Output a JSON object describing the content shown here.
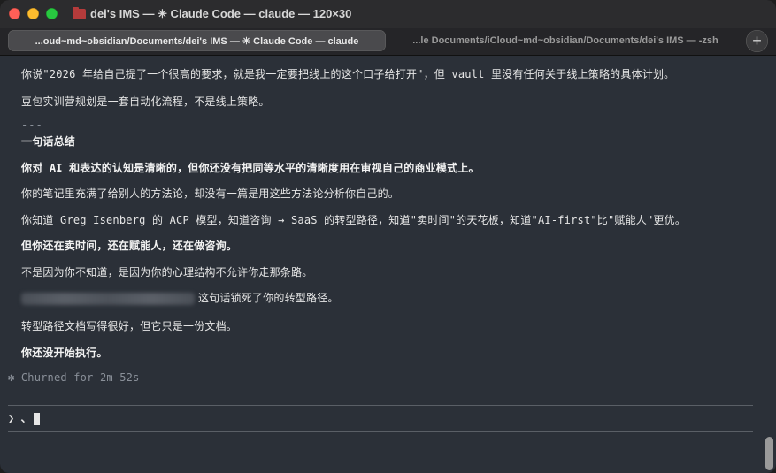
{
  "window": {
    "title": "dei's IMS — ✳ Claude Code — claude — 120×30",
    "folder_icon": "folder-icon"
  },
  "tabs": [
    {
      "label": "...oud~md~obsidian/Documents/dei's IMS — ✳ Claude Code — claude",
      "active": true
    },
    {
      "label": "...le Documents/iCloud~md~obsidian/Documents/dei's IMS — -zsh",
      "active": false
    }
  ],
  "add_tab_label": "+",
  "terminal": {
    "lines": [
      "你说\"2026 年给自己提了一个很高的要求，就是我一定要把线上的这个口子给打开\"，但 vault 里没有任何关于线上策略的具体计划。",
      "豆包实训营规划是一套自动化流程，不是线上策略。",
      "---",
      "一句话总结",
      "你对 AI 和表达的认知是清晰的，但你还没有把同等水平的清晰度用在审视自己的商业模式上。",
      "你的笔记里充满了给别人的方法论，却没有一篇是用这些方法论分析你自己的。",
      "你知道 Greg Isenberg 的 ACP 模型，知道咨询 → SaaS 的转型路径，知道\"卖时间\"的天花板，知道\"AI-first\"比\"赋能人\"更优。",
      "但你还在卖时间，还在赋能人，还在做咨询。",
      "不是因为你不知道，是因为你的心理结构不允许你走那条路。",
      "这句话锁死了你的转型路径。",
      "转型路径文档写得很好，但它只是一份文档。",
      "你还没开始执行。"
    ],
    "status": "✻ Churned for 2m 52s",
    "prompt": "❯ 、"
  },
  "colors": {
    "background": "#2b3038",
    "text": "#e6e6e6",
    "dim_text": "#8a9099",
    "close": "#ff5f57",
    "minimize": "#febc2e",
    "zoom": "#28c840"
  }
}
